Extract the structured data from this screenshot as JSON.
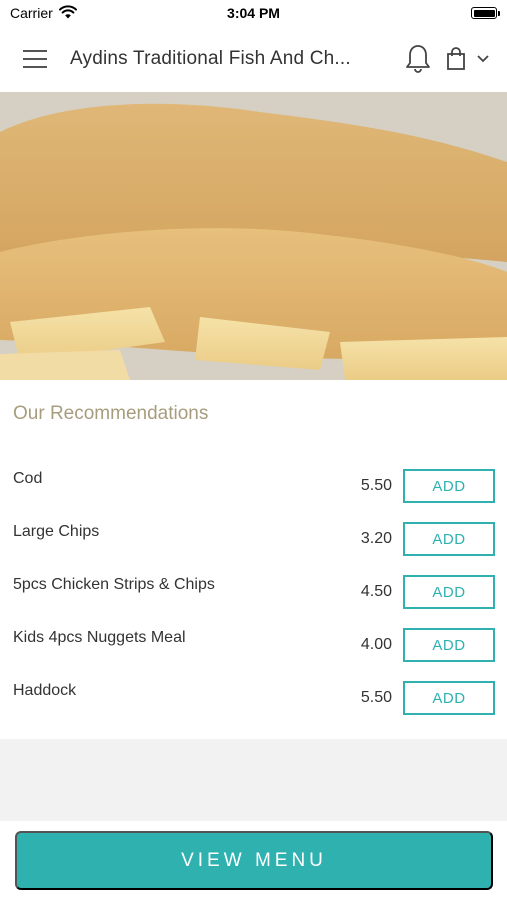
{
  "status_bar": {
    "carrier": "Carrier",
    "time": "3:04 PM",
    "wifi_icon": "wifi-icon",
    "battery_level": 1.0
  },
  "header": {
    "title": "Aydins Traditional Fish And Ch...",
    "menu_icon": "hamburger-icon",
    "notification_icon": "bell-icon",
    "basket_icon": "shopping-bag-icon",
    "dropdown_icon": "chevron-down-icon"
  },
  "hero": {
    "image_description_icon": "fish-and-chips-photo"
  },
  "recommendations": {
    "title": "Our Recommendations",
    "items": [
      {
        "name": "Cod",
        "price": "5.50",
        "button": "ADD"
      },
      {
        "name": "Large Chips",
        "price": "3.20",
        "button": "ADD"
      },
      {
        "name": "5pcs Chicken Strips & Chips",
        "price": "4.50",
        "button": "ADD"
      },
      {
        "name": "Kids 4pcs Nuggets Meal",
        "price": "4.00",
        "button": "ADD"
      },
      {
        "name": "Haddock",
        "price": "5.50",
        "button": "ADD"
      }
    ]
  },
  "footer": {
    "view_menu_label": "VIEW MENU"
  },
  "colors": {
    "accent": "#2fb1b0",
    "section_title": "#a79d7e",
    "grey_background": "#f2f2f2"
  }
}
